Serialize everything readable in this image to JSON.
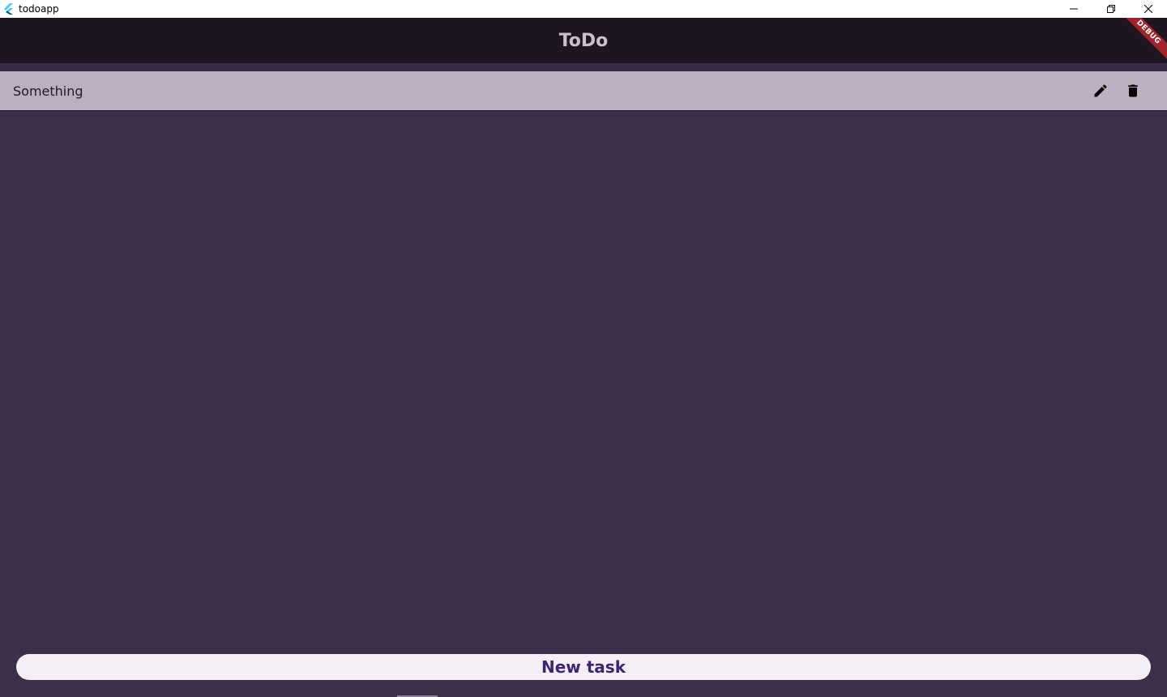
{
  "window": {
    "title": "todoapp",
    "icon": "flutter-logo-icon",
    "controls": [
      "minimize-icon",
      "restore-icon",
      "close-icon"
    ]
  },
  "appbar": {
    "title": "ToDo",
    "debug_banner": "DEBUG"
  },
  "tasks": [
    {
      "label": "Something",
      "actions": [
        "edit-icon",
        "delete-icon"
      ]
    }
  ],
  "footer": {
    "new_task_label": "New task"
  },
  "colors": {
    "background": "#3d2e49",
    "appbar": "#1d1620",
    "task_row": "#bab0c2",
    "button_bg": "#f4eef6",
    "button_text": "#3e2574",
    "debug_banner": "#a0242b"
  }
}
